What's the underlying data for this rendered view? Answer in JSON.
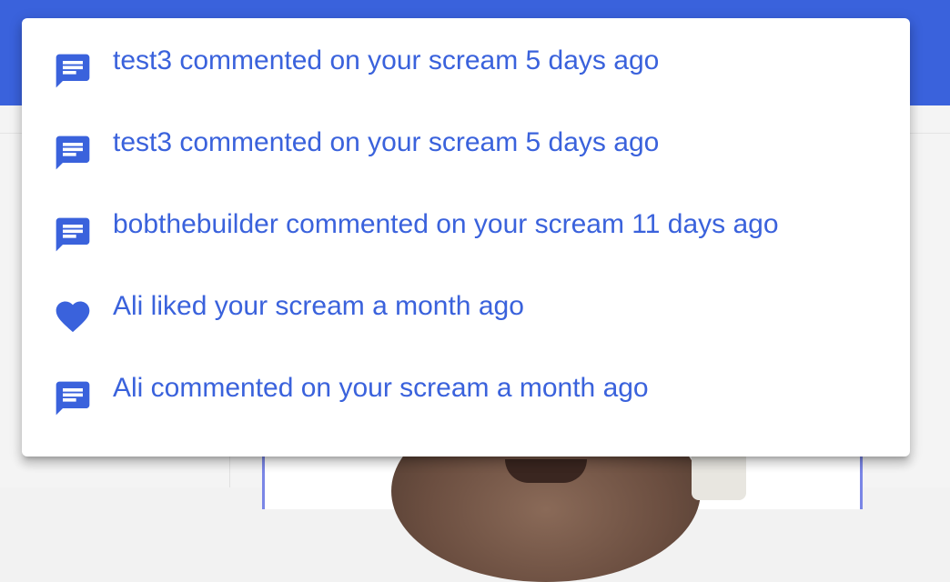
{
  "notifications": [
    {
      "icon": "chat-icon",
      "text": "test3 commented on your scream 5 days ago"
    },
    {
      "icon": "chat-icon",
      "text": "test3 commented on your scream 5 days ago"
    },
    {
      "icon": "chat-icon",
      "text": "bobthebuilder commented on your scream 11 days ago"
    },
    {
      "icon": "heart-icon",
      "text": "Ali liked your scream a month ago"
    },
    {
      "icon": "chat-icon",
      "text": "Ali commented on your scream a month ago"
    }
  ],
  "colors": {
    "accent": "#3a62dc",
    "app_bar": "#3a62dc",
    "menu_background": "#ffffff"
  }
}
